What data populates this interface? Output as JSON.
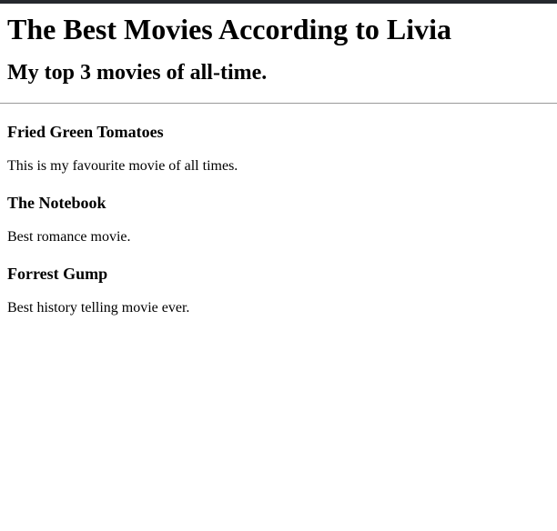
{
  "page": {
    "title": "The Best Movies According to Livia",
    "subtitle": "My top 3 movies of all-time."
  },
  "movies": [
    {
      "title": "Fried Green Tomatoes",
      "description": "This is my favourite movie of all times."
    },
    {
      "title": "The Notebook",
      "description": "Best romance movie."
    },
    {
      "title": "Forrest Gump",
      "description": "Best history telling movie ever."
    }
  ],
  "colors": {
    "top_strip": "#25282d",
    "divider": "#9a9a9a",
    "text": "#000000",
    "background": "#ffffff"
  }
}
